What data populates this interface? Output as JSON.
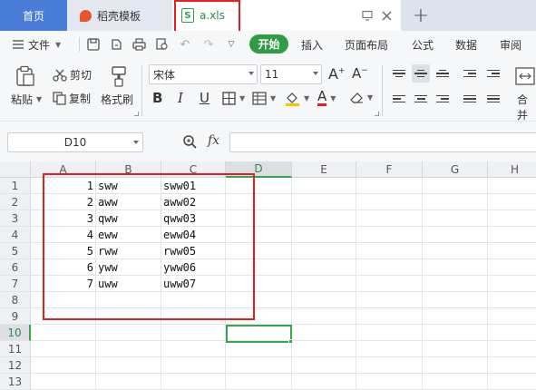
{
  "tabs": {
    "home": "首页",
    "template": "稻壳模板",
    "file": "a.xls",
    "new_tab": "+"
  },
  "menu": {
    "file": "文件",
    "start": "开始",
    "insert": "插入",
    "layout": "页面布局",
    "formula": "公式",
    "data": "数据",
    "review": "审阅"
  },
  "ribbon": {
    "paste": "粘贴",
    "cut": "剪切",
    "copy": "复制",
    "format_painter": "格式刷",
    "font_name": "宋体",
    "font_size": "11",
    "merge": "合并"
  },
  "formula_bar": {
    "name_box": "D10",
    "fx": "fx",
    "formula": ""
  },
  "sheet": {
    "columns": [
      "A",
      "B",
      "C",
      "D",
      "E",
      "F",
      "G",
      "H"
    ],
    "rows": [
      "1",
      "2",
      "3",
      "4",
      "5",
      "6",
      "7",
      "8",
      "9",
      "10",
      "11",
      "12",
      "13"
    ],
    "active_cell": "D10",
    "data": [
      {
        "a": "1",
        "b": "sww",
        "c": "sww01"
      },
      {
        "a": "2",
        "b": "aww",
        "c": "aww02"
      },
      {
        "a": "3",
        "b": "qww",
        "c": "qww03"
      },
      {
        "a": "4",
        "b": "eww",
        "c": "eww04"
      },
      {
        "a": "5",
        "b": "rww",
        "c": "rww05"
      },
      {
        "a": "6",
        "b": "yww",
        "c": "yww06"
      },
      {
        "a": "7",
        "b": "uww",
        "c": "uww07"
      }
    ]
  },
  "colors": {
    "accent_green": "#2e9b45",
    "highlight_red": "#e52020",
    "home_tab_blue": "#4a7dd8"
  }
}
